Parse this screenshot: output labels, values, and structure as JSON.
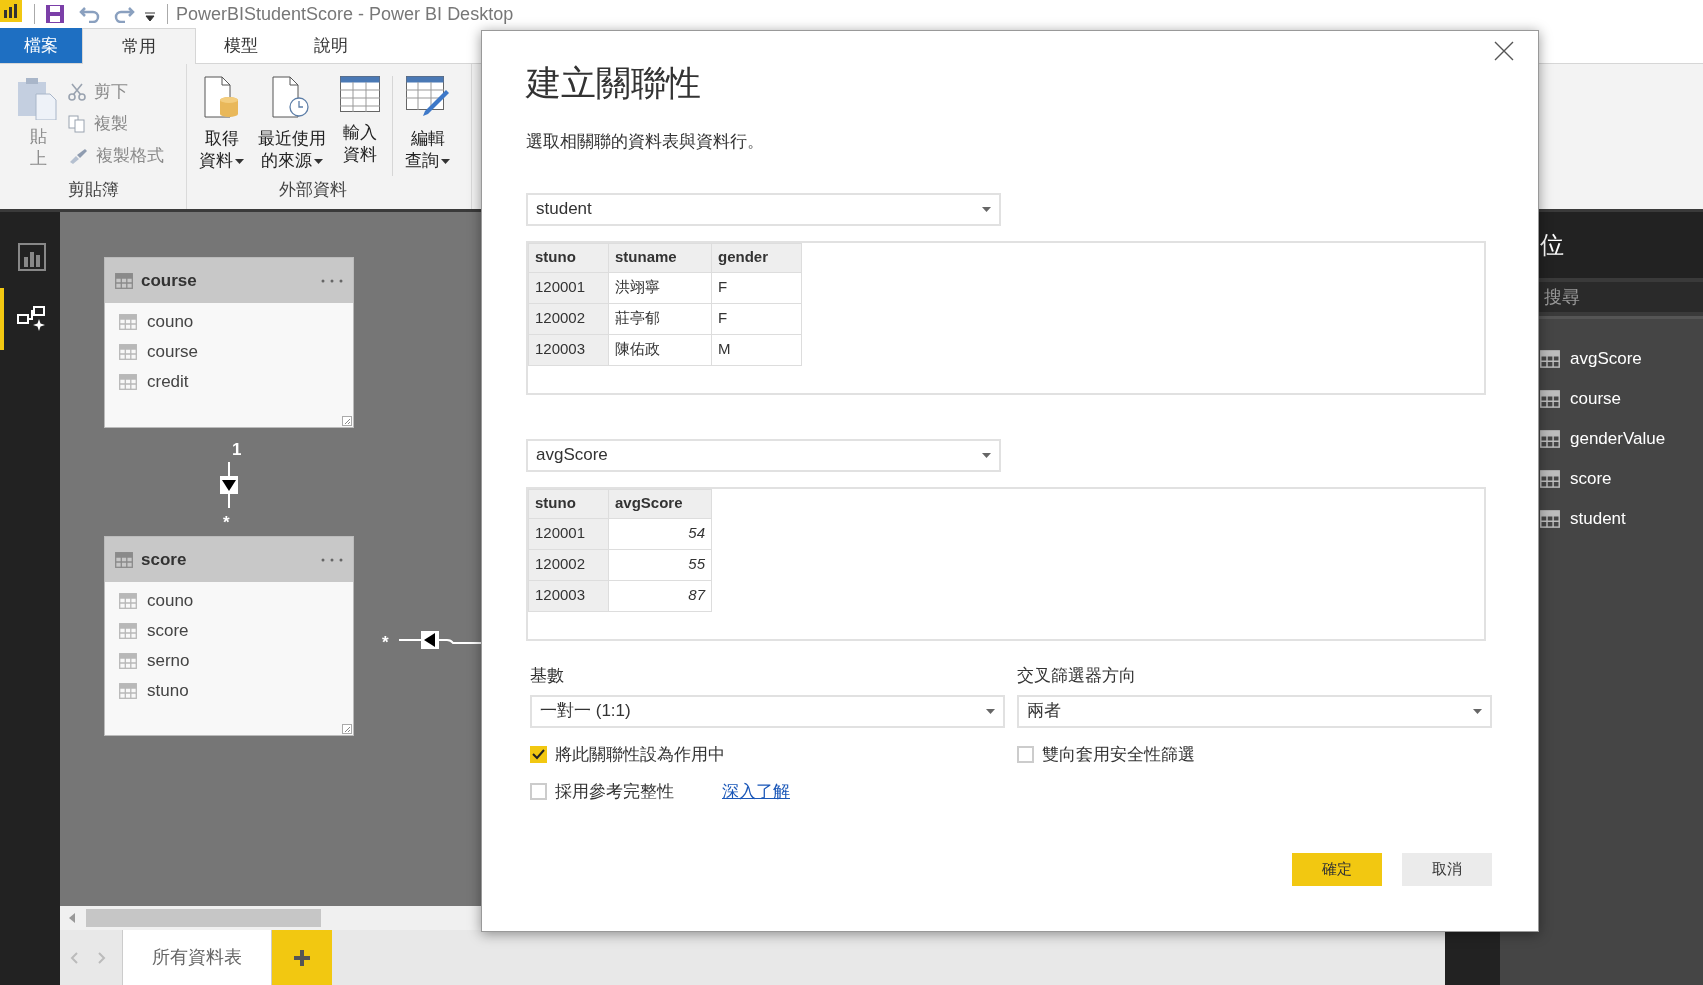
{
  "window": {
    "title": "PowerBIStudentScore - Power BI Desktop"
  },
  "ribbon_tabs": [
    {
      "label": "檔案",
      "kind": "file",
      "selected": false
    },
    {
      "label": "常用",
      "kind": "tab",
      "selected": true
    },
    {
      "label": "模型",
      "kind": "tab",
      "selected": false
    },
    {
      "label": "說明",
      "kind": "tab",
      "selected": false
    }
  ],
  "ribbon_groups": [
    {
      "label": "剪貼簿",
      "buttons": [
        {
          "label": "貼上",
          "kind": "paste",
          "disabled": true
        },
        {
          "label": "剪下",
          "kind": "cut",
          "disabled": true
        },
        {
          "label": "複製",
          "kind": "copy",
          "disabled": true
        },
        {
          "label": "複製格式",
          "kind": "format",
          "disabled": true
        }
      ]
    },
    {
      "label": "外部資料",
      "buttons": [
        {
          "label": "取得資料",
          "kind": "get",
          "dropdown": true
        },
        {
          "label": "最近使用的來源",
          "kind": "recent",
          "dropdown": true
        },
        {
          "label": "輸入資料",
          "kind": "enter",
          "dropdown": false
        },
        {
          "label": "編輯查詢",
          "kind": "edit",
          "dropdown": true
        }
      ]
    }
  ],
  "left_nav": [
    {
      "kind": "report",
      "selected": false
    },
    {
      "kind": "model",
      "selected": true
    }
  ],
  "model_tables": [
    {
      "name": "course",
      "fields": [
        "couno",
        "course",
        "credit"
      ]
    },
    {
      "name": "score",
      "fields": [
        "couno",
        "score",
        "serno",
        "stuno"
      ]
    }
  ],
  "relationships": [
    {
      "kind": "vertical",
      "start": "1",
      "end": "*"
    },
    {
      "kind": "horizontal",
      "end": "*"
    }
  ],
  "page_tabs": [
    {
      "label": "所有資料表",
      "selected": true
    }
  ],
  "fields_pane": {
    "title": "位",
    "search_placeholder": "搜尋",
    "tables": [
      "avgScore",
      "course",
      "genderValue",
      "score",
      "student"
    ]
  },
  "dialog": {
    "title": "建立關聯性",
    "subtitle": "選取相關聯的資料表與資料行。",
    "tables": [
      {
        "selector": "student",
        "columns": [
          {
            "name": "stuno",
            "kind": "text"
          },
          {
            "name": "stuname",
            "kind": "text"
          },
          {
            "name": "gender",
            "kind": "text"
          }
        ],
        "rows": [
          [
            "120001",
            "洪翊寧",
            "F"
          ],
          [
            "120002",
            "莊亭郁",
            "F"
          ],
          [
            "120003",
            "陳佑政",
            "M"
          ]
        ]
      },
      {
        "selector": "avgScore",
        "columns": [
          {
            "name": "stuno",
            "kind": "text"
          },
          {
            "name": "avgScore",
            "kind": "number"
          }
        ],
        "rows": [
          [
            "120001",
            "54"
          ],
          [
            "120002",
            "55"
          ],
          [
            "120003",
            "87"
          ]
        ]
      }
    ],
    "cardinality": {
      "label": "基數",
      "value": "一對一 (1:1)"
    },
    "cross_filter": {
      "label": "交叉篩選器方向",
      "value": "兩者"
    },
    "options": [
      {
        "label": "將此關聯性設為作用中",
        "checked": true
      },
      {
        "label": "雙向套用安全性篩選",
        "checked": false
      },
      {
        "label": "採用參考完整性",
        "checked": false
      }
    ],
    "learn_more_link": "深入了解",
    "buttons": [
      {
        "label": "確定",
        "kind": "primary"
      },
      {
        "label": "取消",
        "kind": "secondary"
      }
    ]
  }
}
